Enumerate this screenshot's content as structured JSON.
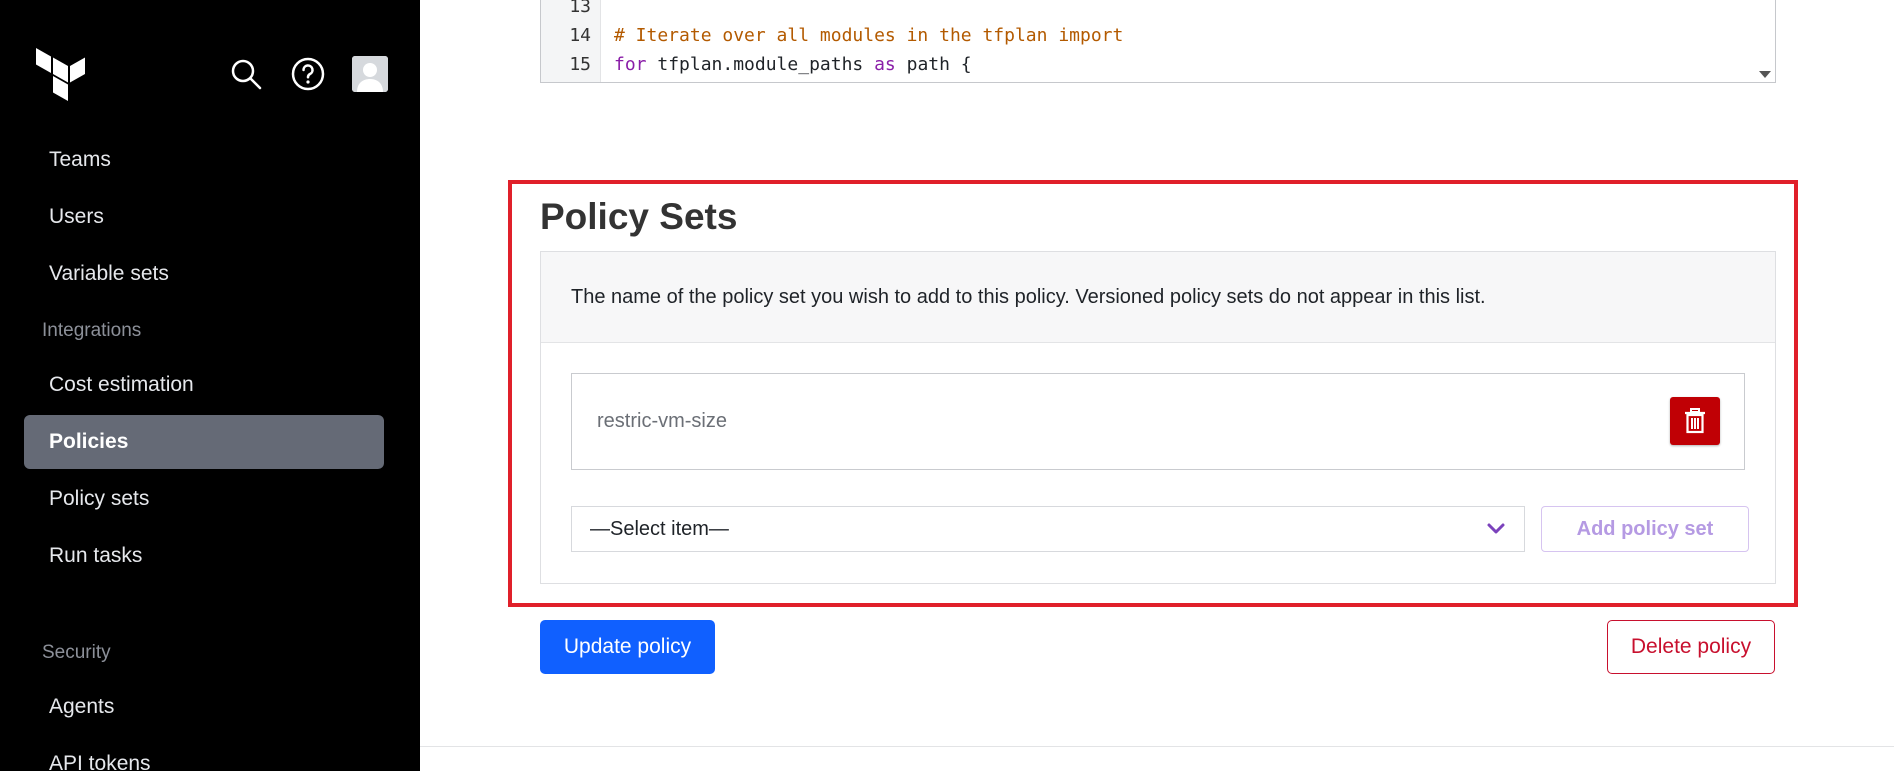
{
  "sidebar": {
    "items": [
      {
        "label": "Teams"
      },
      {
        "label": "Users"
      },
      {
        "label": "Variable sets"
      }
    ],
    "section_integrations": "Integrations",
    "integration_items": [
      {
        "label": "Cost estimation"
      },
      {
        "label": "Policies",
        "active": true
      },
      {
        "label": "Policy sets"
      },
      {
        "label": "Run tasks"
      }
    ],
    "section_security": "Security",
    "security_items": [
      {
        "label": "Agents"
      },
      {
        "label": "API tokens"
      }
    ]
  },
  "header_icons": [
    "terraform-logo-icon",
    "search-icon",
    "help-icon",
    "user-avatar-icon"
  ],
  "code": {
    "lines": [
      {
        "num": "13",
        "text": ""
      },
      {
        "num": "14",
        "comment": "# Iterate over all modules in the tfplan import"
      },
      {
        "num": "15",
        "kw1": "for",
        "mid": " tfplan.module_paths ",
        "kw2": "as",
        "end": " path {"
      }
    ]
  },
  "policy_sets": {
    "title": "Policy Sets",
    "description": "The name of the policy set you wish to add to this policy. Versioned policy sets do not appear in this list.",
    "items": [
      {
        "name": "restric-vm-size"
      }
    ],
    "select_value": "—Select item—",
    "add_button": "Add policy set"
  },
  "actions": {
    "update": "Update policy",
    "delete": "Delete policy"
  },
  "colors": {
    "sidebar_bg": "#000000",
    "active_item": "#656a76",
    "primary": "#1060ff",
    "danger": "#c00005",
    "highlight": "#e0202a",
    "accent_purple": "#7b42bc"
  }
}
